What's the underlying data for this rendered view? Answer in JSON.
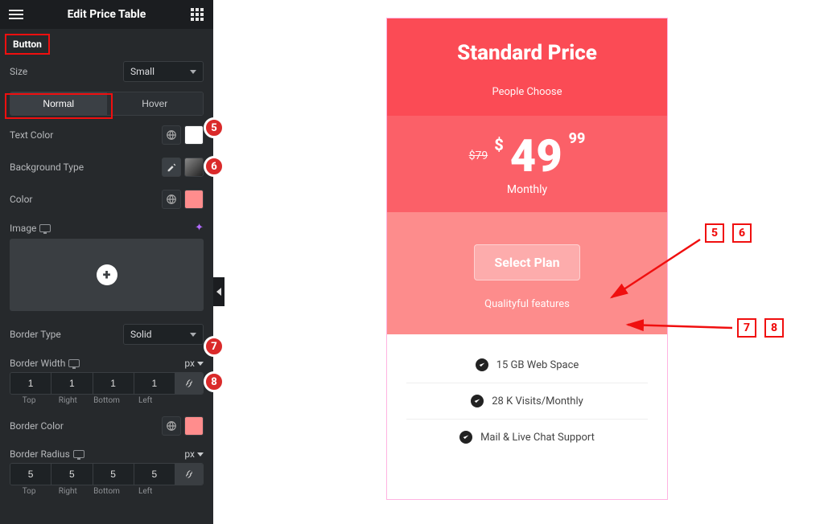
{
  "header": {
    "title": "Edit Price Table"
  },
  "accordion": {
    "button_label": "Button"
  },
  "size": {
    "label": "Size",
    "value": "Small"
  },
  "state_tabs": {
    "normal": "Normal",
    "hover": "Hover"
  },
  "text_color": {
    "label": "Text Color"
  },
  "bg_type": {
    "label": "Background Type"
  },
  "color": {
    "label": "Color"
  },
  "image": {
    "label": "Image"
  },
  "border_type": {
    "label": "Border Type",
    "value": "Solid"
  },
  "border_width": {
    "label": "Border Width",
    "unit": "px",
    "top": "1",
    "right": "1",
    "bottom": "1",
    "left": "1",
    "lbl_top": "Top",
    "lbl_right": "Right",
    "lbl_bottom": "Bottom",
    "lbl_left": "Left"
  },
  "border_color": {
    "label": "Border Color"
  },
  "border_radius": {
    "label": "Border Radius",
    "unit": "px",
    "top": "5",
    "right": "5",
    "bottom": "5",
    "left": "5",
    "lbl_top": "Top",
    "lbl_right": "Right",
    "lbl_bottom": "Bottom",
    "lbl_left": "Left"
  },
  "badges": {
    "b5": "5",
    "b6": "6",
    "b7": "7",
    "b8": "8"
  },
  "right_badges": {
    "r5": "5",
    "r6": "6",
    "r7": "7",
    "r8": "8"
  },
  "preview": {
    "title": "Standard Price",
    "subtitle": "People Choose",
    "old_price": "$79",
    "currency": "$",
    "amount": "49",
    "cents": "99",
    "period": "Monthly",
    "cta": "Select Plan",
    "cta_sub": "Qualityful features",
    "features": {
      "f1": "15 GB Web Space",
      "f2": "28 K Visits/Monthly",
      "f3": "Mail & Live Chat Support"
    }
  }
}
